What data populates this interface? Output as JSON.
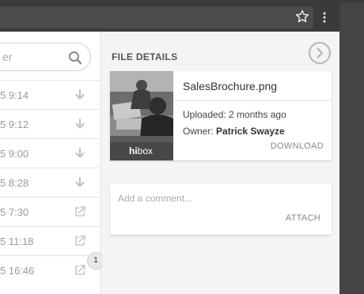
{
  "browser": {
    "star_icon": "star-icon",
    "menu_icon": "kebab-menu-icon"
  },
  "search": {
    "placeholder": "er",
    "icon": "search-icon"
  },
  "list": [
    {
      "time": "5 9:14",
      "icon": "download-icon"
    },
    {
      "time": "5 9:12",
      "icon": "download-icon"
    },
    {
      "time": "5 9:00",
      "icon": "download-icon"
    },
    {
      "time": "5 8:28",
      "icon": "download-icon"
    },
    {
      "time": "5 7:30",
      "icon": "external-link-icon"
    },
    {
      "time": "5 11:18",
      "icon": "external-link-icon"
    },
    {
      "time": "5 16:46",
      "icon": "external-link-icon"
    }
  ],
  "badge": {
    "count": "1"
  },
  "details": {
    "title": "FILE DETAILS",
    "next_icon": "chevron-right-circle-icon",
    "thumb_brand_bold": "hi",
    "thumb_brand_rest": "box",
    "file_name": "SalesBrochure.png",
    "uploaded": "Uploaded: 2 months ago",
    "owner_label": "Owner: ",
    "owner_name": "Patrick Swayze",
    "download_label": "DOWNLOAD"
  },
  "comment": {
    "placeholder": "Add a comment...",
    "attach_label": "ATTACH"
  },
  "colors": {
    "chrome": "#3a3a3a",
    "pane": "#f4f4f4",
    "muted": "#888888"
  }
}
